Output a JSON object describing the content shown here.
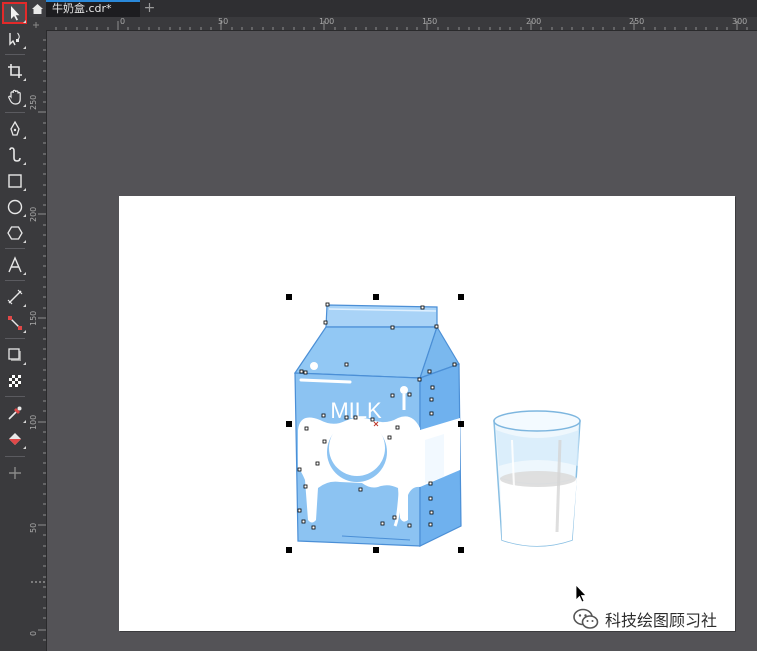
{
  "document": {
    "tab_title": "牛奶盒.cdr*"
  },
  "artwork": {
    "carton_label": "MILK"
  },
  "rulers": {
    "horizontal": [
      "0",
      "50",
      "100",
      "150",
      "200",
      "250",
      "300"
    ],
    "vertical": [
      "250",
      "200",
      "150",
      "100",
      "50",
      "0"
    ]
  },
  "watermark": {
    "text": "科技绘图顾习社"
  },
  "colors": {
    "accent": "#2a88d8",
    "selected_outline": "#e32a2a",
    "milk_blue": "#8cc3f2"
  },
  "toolbox": {
    "tools": [
      "pick-tool",
      "shape-tool",
      "crop-tool",
      "pan-tool",
      "freehand-tool",
      "artistic-media-tool",
      "rectangle-tool",
      "ellipse-tool",
      "polygon-tool",
      "text-tool",
      "parallel-dimension-tool",
      "connector-tool",
      "drop-shadow-tool",
      "transparency-tool",
      "eyedropper-tool",
      "interactive-fill-tool",
      "add-tool"
    ],
    "selected": "pick-tool"
  }
}
